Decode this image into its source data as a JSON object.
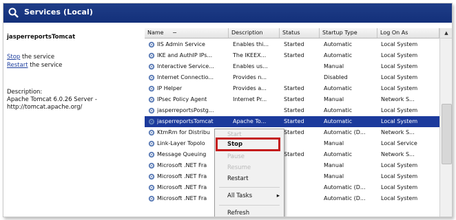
{
  "window": {
    "title": "Services (Local)"
  },
  "left_panel": {
    "service_name": "jasperreportsTomcat",
    "stop_link": "Stop",
    "stop_suffix": " the service",
    "restart_link": "Restart",
    "restart_suffix": " the service",
    "description_label": "Description:",
    "description_line1": "Apache Tomcat 6.0.26 Server -",
    "description_line2": "http://tomcat.apache.org/"
  },
  "table": {
    "headers": {
      "name": "Name",
      "sort_indicator": "−",
      "description": "Description",
      "status": "Status",
      "startup_type": "Startup Type",
      "log_on_as": "Log On As"
    },
    "rows": [
      {
        "name": "IIS Admin Service",
        "description": "Enables thi...",
        "status": "Started",
        "startup": "Automatic",
        "logon": "Local System"
      },
      {
        "name": "IKE and AuthIP IPs...",
        "description": "The IKEEX...",
        "status": "Started",
        "startup": "Automatic",
        "logon": "Local System"
      },
      {
        "name": "Interactive Service...",
        "description": "Enables us...",
        "status": "",
        "startup": "Manual",
        "logon": "Local System"
      },
      {
        "name": "Internet Connectio...",
        "description": "Provides n...",
        "status": "",
        "startup": "Disabled",
        "logon": "Local System"
      },
      {
        "name": "IP Helper",
        "description": "Provides a...",
        "status": "Started",
        "startup": "Automatic",
        "logon": "Local System"
      },
      {
        "name": "IPsec Policy Agent",
        "description": "Internet Pr...",
        "status": "Started",
        "startup": "Manual",
        "logon": "Network S..."
      },
      {
        "name": "jasperreportsPostg...",
        "description": "",
        "status": "Started",
        "startup": "Automatic",
        "logon": "Local System"
      },
      {
        "name": "jasperreportsTomcat",
        "description": "Apache To...",
        "status": "Started",
        "startup": "Automatic",
        "logon": "Local System"
      },
      {
        "name": "KtmRm for Distribu",
        "description": "",
        "status": "Started",
        "startup": "Automatic (D...",
        "logon": "Network S..."
      },
      {
        "name": "Link-Layer Topolo",
        "description": "",
        "status": "",
        "startup": "Manual",
        "logon": "Local Service"
      },
      {
        "name": "Message Queuing",
        "description": "",
        "status": "Started",
        "startup": "Automatic",
        "logon": "Network S..."
      },
      {
        "name": "Microsoft .NET Fra",
        "description": "",
        "status": "",
        "startup": "Manual",
        "logon": "Local System"
      },
      {
        "name": "Microsoft .NET Fra",
        "description": "",
        "status": "",
        "startup": "Manual",
        "logon": "Local System"
      },
      {
        "name": "Microsoft .NET Fra",
        "description": "",
        "status": "",
        "startup": "Automatic (D...",
        "logon": "Local System"
      },
      {
        "name": "Microsoft .NET Fra",
        "description": "",
        "status": "",
        "startup": "Automatic (D...",
        "logon": "Local System"
      }
    ]
  },
  "context_menu": {
    "start": "Start",
    "stop": "Stop",
    "pause": "Pause",
    "resume": "Resume",
    "restart": "Restart",
    "all_tasks": "All Tasks",
    "refresh": "Refresh"
  },
  "colors": {
    "titlebar": "#13307a",
    "selection": "#1c3a9c",
    "link": "#1e3f9e",
    "highlight_box": "#c41a1a"
  }
}
